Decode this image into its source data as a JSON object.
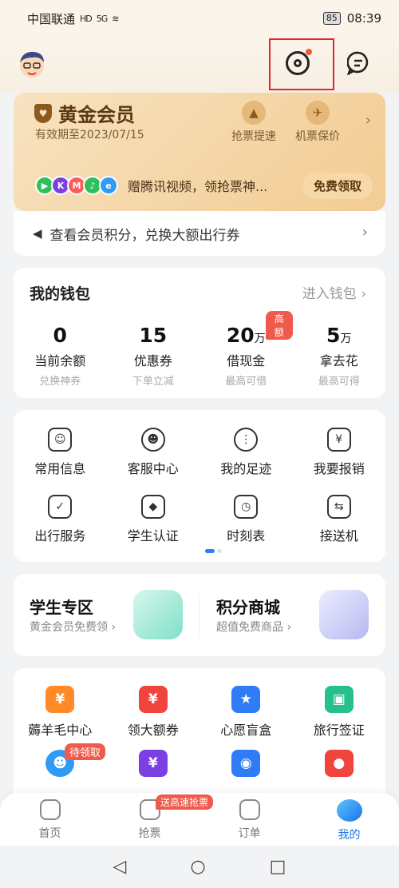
{
  "status_bar": {
    "carrier": "中国联通",
    "hd": "HD",
    "signal": "5G",
    "battery": "85",
    "time": "08:39"
  },
  "membership": {
    "title": "黄金会员",
    "expiry": "有效期至2023/07/15",
    "perks": [
      {
        "label": "抢票提速",
        "icon": "rocket-icon"
      },
      {
        "label": "机票保价",
        "icon": "plane-icon"
      }
    ],
    "promo_text": "赠腾讯视频，领抢票神...",
    "promo_button": "免费领取",
    "points_text": "查看会员积分，兑换大额出行券"
  },
  "wallet": {
    "title": "我的钱包",
    "link": "进入钱包",
    "items": [
      {
        "value": "0",
        "unit": "",
        "label": "当前余额",
        "sub": "兑换神券"
      },
      {
        "value": "15",
        "unit": "",
        "label": "优惠券",
        "sub": "下单立减"
      },
      {
        "value": "20",
        "unit": "万",
        "label": "借现金",
        "sub": "最高可借",
        "tag": "高额"
      },
      {
        "value": "5",
        "unit": "万",
        "label": "拿去花",
        "sub": "最高可得"
      }
    ]
  },
  "services": [
    {
      "label": "常用信息",
      "icon": "id-card-icon"
    },
    {
      "label": "客服中心",
      "icon": "customer-service-icon"
    },
    {
      "label": "我的足迹",
      "icon": "footprint-icon"
    },
    {
      "label": "我要报销",
      "icon": "reimburse-icon"
    },
    {
      "label": "出行服务",
      "icon": "travel-bag-icon"
    },
    {
      "label": "学生认证",
      "icon": "graduation-cap-icon"
    },
    {
      "label": "时刻表",
      "icon": "clock-icon"
    },
    {
      "label": "接送机",
      "icon": "car-icon"
    }
  ],
  "zones": {
    "student": {
      "title": "学生专区",
      "sub": "黄金会员免费领"
    },
    "points": {
      "title": "积分商城",
      "sub": "超值免费商品"
    }
  },
  "bottom_grid": [
    {
      "label": "薅羊毛中心",
      "color": "#ff8a2a",
      "glyph": "¥"
    },
    {
      "label": "领大额券",
      "color": "#f0443c",
      "glyph": "¥"
    },
    {
      "label": "心愿盲盒",
      "color": "#2f7cf6",
      "glyph": "★"
    },
    {
      "label": "旅行签证",
      "color": "#26c08a",
      "glyph": "✈"
    }
  ],
  "bottom_grid_row2_tag": "待领取",
  "tabbar": {
    "items": [
      "首页",
      "抢票",
      "订单",
      "我的"
    ],
    "ticket_tag": "送高速抢票"
  },
  "colors": {
    "accent": "#1a73e8",
    "highlight": "#e0262c",
    "tag": "#f05a4c"
  }
}
